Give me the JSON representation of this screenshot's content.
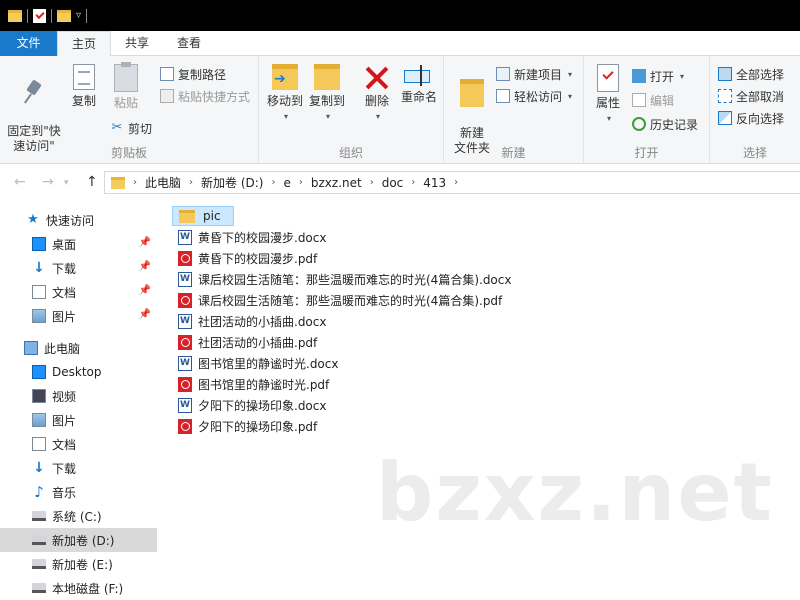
{
  "ribbon_tabs": {
    "file": "文件",
    "home": "主页",
    "share": "共享",
    "view": "查看"
  },
  "ribbon": {
    "clipboard": {
      "label": "剪贴板",
      "pin": "固定到\"快\n速访问\"",
      "copy": "复制",
      "paste": "粘贴",
      "copy_path": "复制路径",
      "paste_shortcut": "粘贴快捷方式",
      "cut": "剪切"
    },
    "organize": {
      "label": "组织",
      "move_to": "移动到",
      "copy_to": "复制到",
      "delete": "删除",
      "rename": "重命名"
    },
    "new": {
      "label": "新建",
      "new_folder": "新建\n文件夹",
      "new_item": "新建项目",
      "easy_access": "轻松访问"
    },
    "open": {
      "label": "打开",
      "properties": "属性",
      "open": "打开",
      "edit": "编辑",
      "history": "历史记录"
    },
    "select": {
      "label": "选择",
      "select_all": "全部选择",
      "select_none": "全部取消",
      "invert": "反向选择"
    }
  },
  "address": {
    "parts": [
      "此电脑",
      "新加卷 (D:)",
      "e",
      "bzxz.net",
      "doc",
      "413"
    ]
  },
  "sidebar": {
    "quick_access": "快速访问",
    "quick_items": [
      "桌面",
      "下载",
      "文档",
      "图片"
    ],
    "this_pc": "此电脑",
    "pc_items": [
      "Desktop",
      "视频",
      "图片",
      "文档",
      "下载",
      "音乐",
      "系统 (C:)",
      "新加卷 (D:)",
      "新加卷 (E:)",
      "本地磁盘 (F:)"
    ]
  },
  "files": [
    {
      "name": "pic",
      "type": "folder"
    },
    {
      "name": "黄昏下的校园漫步.docx",
      "type": "docx"
    },
    {
      "name": "黄昏下的校园漫步.pdf",
      "type": "pdf"
    },
    {
      "name": "课后校园生活随笔：那些温暖而难忘的时光(4篇合集).docx",
      "type": "docx"
    },
    {
      "name": "课后校园生活随笔：那些温暖而难忘的时光(4篇合集).pdf",
      "type": "pdf"
    },
    {
      "name": "社团活动的小插曲.docx",
      "type": "docx"
    },
    {
      "name": "社团活动的小插曲.pdf",
      "type": "pdf"
    },
    {
      "name": "图书馆里的静谧时光.docx",
      "type": "docx"
    },
    {
      "name": "图书馆里的静谧时光.pdf",
      "type": "pdf"
    },
    {
      "name": "夕阳下的操场印象.docx",
      "type": "docx"
    },
    {
      "name": "夕阳下的操场印象.pdf",
      "type": "pdf"
    }
  ],
  "watermark": "bzxz.net",
  "colors": {
    "file_tab": "#1979ca",
    "selection": "#cce8ff",
    "pdf": "#d8222a",
    "docx": "#2b579a",
    "folder": "#f5c85a"
  }
}
